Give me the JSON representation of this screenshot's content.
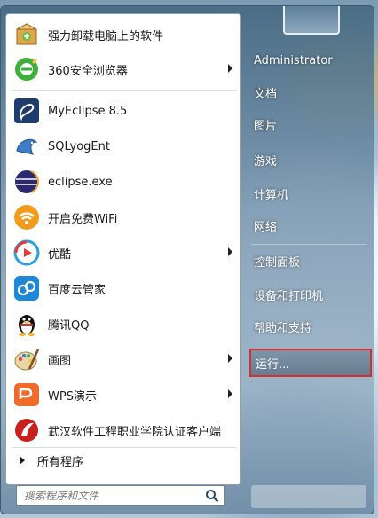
{
  "start_menu": {
    "programs": [
      {
        "label": "强力卸载电脑上的软件",
        "icon": "uninstall-box-icon",
        "submenu": false
      },
      {
        "label": "360安全浏览器",
        "icon": "360-browser-icon",
        "submenu": true
      },
      {
        "label": "MyEclipse 8.5",
        "icon": "myeclipse-icon",
        "submenu": false
      },
      {
        "label": "SQLyogEnt",
        "icon": "sqlyog-dolphin-icon",
        "submenu": false
      },
      {
        "label": "eclipse.exe",
        "icon": "eclipse-icon",
        "submenu": false
      },
      {
        "label": "开启免费WiFi",
        "icon": "wifi-icon",
        "submenu": false
      },
      {
        "label": "优酷",
        "icon": "youku-play-icon",
        "submenu": true
      },
      {
        "label": "百度云管家",
        "icon": "baidu-cloud-icon",
        "submenu": false
      },
      {
        "label": "腾讯QQ",
        "icon": "qq-penguin-icon",
        "submenu": false
      },
      {
        "label": "画图",
        "icon": "paint-palette-icon",
        "submenu": true
      },
      {
        "label": "WPS演示",
        "icon": "wps-presentation-icon",
        "submenu": true
      },
      {
        "label": "武汉软件工程职业学院认证客户端",
        "icon": "campus-client-icon",
        "submenu": false
      }
    ],
    "all_programs": "所有程序",
    "search_placeholder": "搜索程序和文件",
    "right_links": [
      {
        "label": "Administrator"
      },
      {
        "label": "文档"
      },
      {
        "label": "图片"
      },
      {
        "label": "游戏"
      },
      {
        "label": "计算机"
      },
      {
        "label": "网络"
      },
      {
        "label": "控制面板"
      },
      {
        "label": "设备和打印机"
      },
      {
        "label": "帮助和支持"
      }
    ],
    "run_label": "运行...",
    "highlight_color": "#d03232"
  }
}
